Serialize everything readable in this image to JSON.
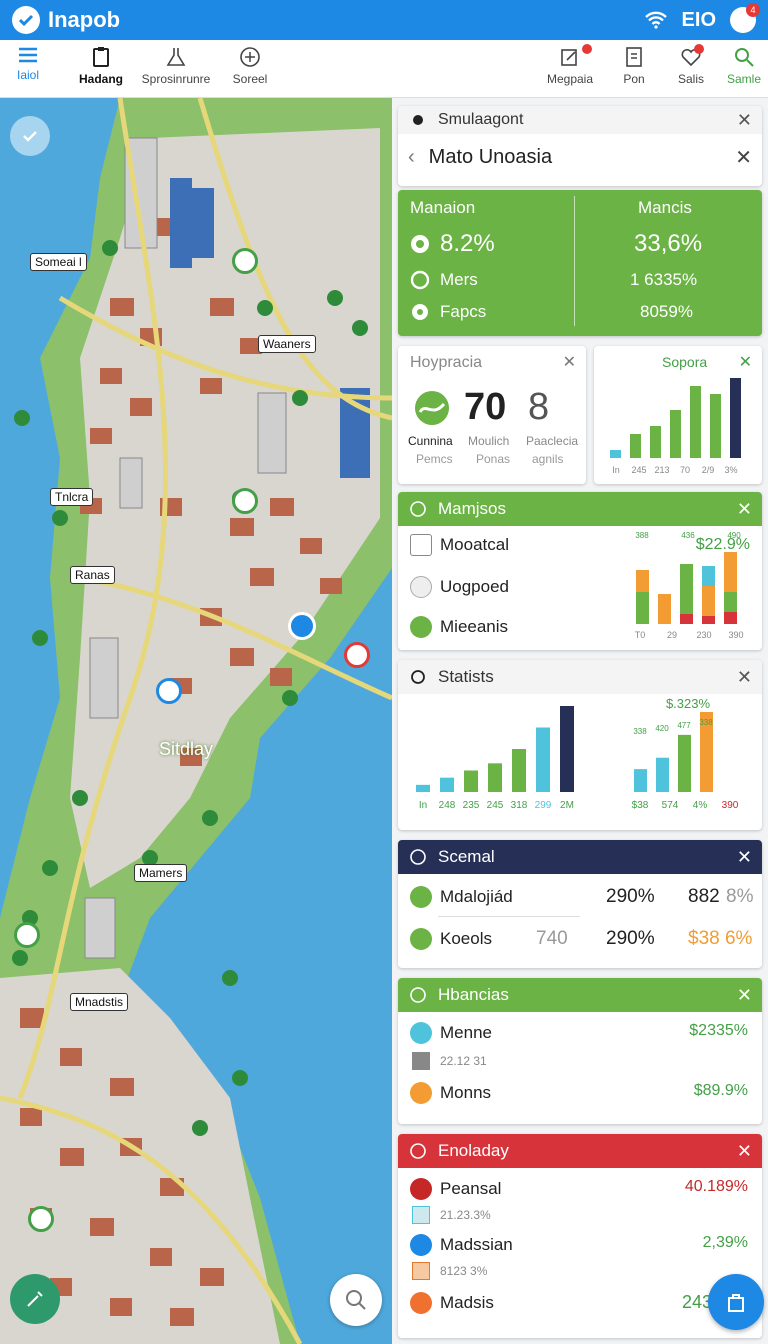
{
  "app": {
    "name": "Inapob",
    "signal": "EIO",
    "badge": "4"
  },
  "toolbar": {
    "menu": "Iaiol",
    "tab1": "Hadang",
    "tab2": "Sprosinrunre",
    "tab3": "Soreel",
    "t4": "Megpaia",
    "t5": "Pon",
    "t6": "Salis",
    "t7": "Samle"
  },
  "map": {
    "labels": {
      "l1": "Someai l",
      "l2": "Waaners",
      "l3": "Tnlcra",
      "l4": "Ranas",
      "l5": "Sitdlay",
      "l6": "Mamers",
      "l7": "Mnadstis"
    }
  },
  "search": {
    "title": "Smulaagont",
    "query": "Mato Unoasia"
  },
  "summary": {
    "col1": "Manaion",
    "col2": "Mancis",
    "r1_label": "8.2%",
    "r1_val": "33,6%",
    "r2_label": "Mers",
    "r2_val": "1 6335%",
    "r3_label": "Fapcs",
    "r3_val": "8059%"
  },
  "gauge": {
    "title": "Hoypracia",
    "big": "70",
    "big2": "8",
    "l1": "Cunnina",
    "l2": "Moulich",
    "l3": "Paaclecia",
    "s1": "Pemcs",
    "s2": "Ponas",
    "s3": "agnils"
  },
  "mini": {
    "title": "Sopora",
    "ticks": [
      "In",
      "245",
      "213",
      "70",
      "2/9",
      "3%"
    ],
    "values": [
      1,
      3,
      4,
      6,
      9,
      8,
      10
    ]
  },
  "mamjsos": {
    "title": "Mamjsos",
    "r1": "Mooatcal",
    "r1v": "$22.9%",
    "r2": "Uogpoed",
    "r3": "Mieeanis",
    "ticks": [
      "T0",
      "29",
      "230",
      "390"
    ],
    "top_labels": [
      "388",
      "436",
      "490"
    ]
  },
  "statists": {
    "title": "Statists",
    "ticks1": [
      "In",
      "248",
      "235",
      "245",
      "318",
      "299",
      "2M"
    ],
    "vals1": [
      1,
      2,
      3,
      4,
      6,
      9,
      12
    ],
    "top": "$.323%",
    "ticks2": [
      "$38",
      "574",
      "4%",
      "390"
    ],
    "tl2": [
      "338",
      "420",
      "477",
      "338"
    ]
  },
  "scemal": {
    "title": "Scemal",
    "r1": "Mdalojiád",
    "r1a": "290%",
    "r1b": "882",
    "r1c": "8%",
    "r2": "Koeols",
    "r2x": "740",
    "r2a": "290%",
    "r2b": "$38 6%"
  },
  "hbancias": {
    "title": "Hbancias",
    "r1": "Menne",
    "r1v": "$2335%",
    "sub": "22.12 31",
    "r2": "Monns",
    "r2v": "$89.9%"
  },
  "enoladay": {
    "title": "Enoladay",
    "r1": "Peansal",
    "r1v": "40.189%",
    "s1": "21.23.3%",
    "r2": "Madssian",
    "r2v": "2,39%",
    "s2": "8123 3%",
    "r3": "Madsis",
    "r3v": "243"
  },
  "colors": {
    "green": "#6ab344",
    "navy": "#263056",
    "red": "#d6343a",
    "blue": "#1e88e5",
    "cyan": "#4fc3dc",
    "orange": "#f39c33"
  }
}
